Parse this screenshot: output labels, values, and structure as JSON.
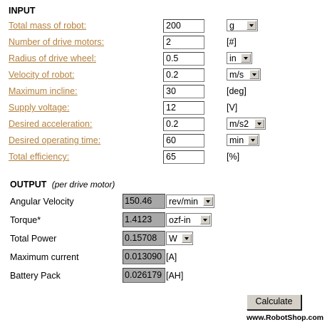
{
  "input": {
    "heading": "INPUT",
    "rows": [
      {
        "label": "Total mass of robot:",
        "value": "200",
        "unit": "g",
        "unit_type": "select"
      },
      {
        "label": "Number of drive motors:",
        "value": "2",
        "unit": "[#]",
        "unit_type": "text"
      },
      {
        "label": "Radius of drive wheel:",
        "value": "0.5",
        "unit": "in",
        "unit_type": "select"
      },
      {
        "label": "Velocity of robot:",
        "value": "0.2",
        "unit": "m/s",
        "unit_type": "select"
      },
      {
        "label": "Maximum incline:",
        "value": "30",
        "unit": "[deg]",
        "unit_type": "text"
      },
      {
        "label": "Supply voltage:",
        "value": "12",
        "unit": "[V]",
        "unit_type": "text"
      },
      {
        "label": "Desired acceleration:",
        "value": "0.2",
        "unit": "m/s2",
        "unit_type": "select"
      },
      {
        "label": "Desired operating time:",
        "value": "60",
        "unit": "min",
        "unit_type": "select"
      },
      {
        "label": "Total efficiency:",
        "value": "65",
        "unit": "[%]",
        "unit_type": "text"
      }
    ]
  },
  "output": {
    "heading": "OUTPUT",
    "subheading": "(per drive motor)",
    "rows": [
      {
        "label": "Angular Velocity",
        "value": "150.46",
        "unit": "rev/min",
        "unit_type": "select"
      },
      {
        "label": "Torque*",
        "value": "1.4123",
        "unit": "ozf-in",
        "unit_type": "select"
      },
      {
        "label": "Total Power",
        "value": "0.15708",
        "unit": "W",
        "unit_type": "select"
      },
      {
        "label": "Maximum current",
        "value": "0.013090",
        "unit": "[A]",
        "unit_type": "text"
      },
      {
        "label": "Battery Pack",
        "value": "0.026179",
        "unit": "[AH]",
        "unit_type": "text"
      }
    ]
  },
  "calculate_label": "Calculate",
  "site": "www.RobotShop.com",
  "icons": {
    "dropdown": "chevron-down-icon"
  }
}
